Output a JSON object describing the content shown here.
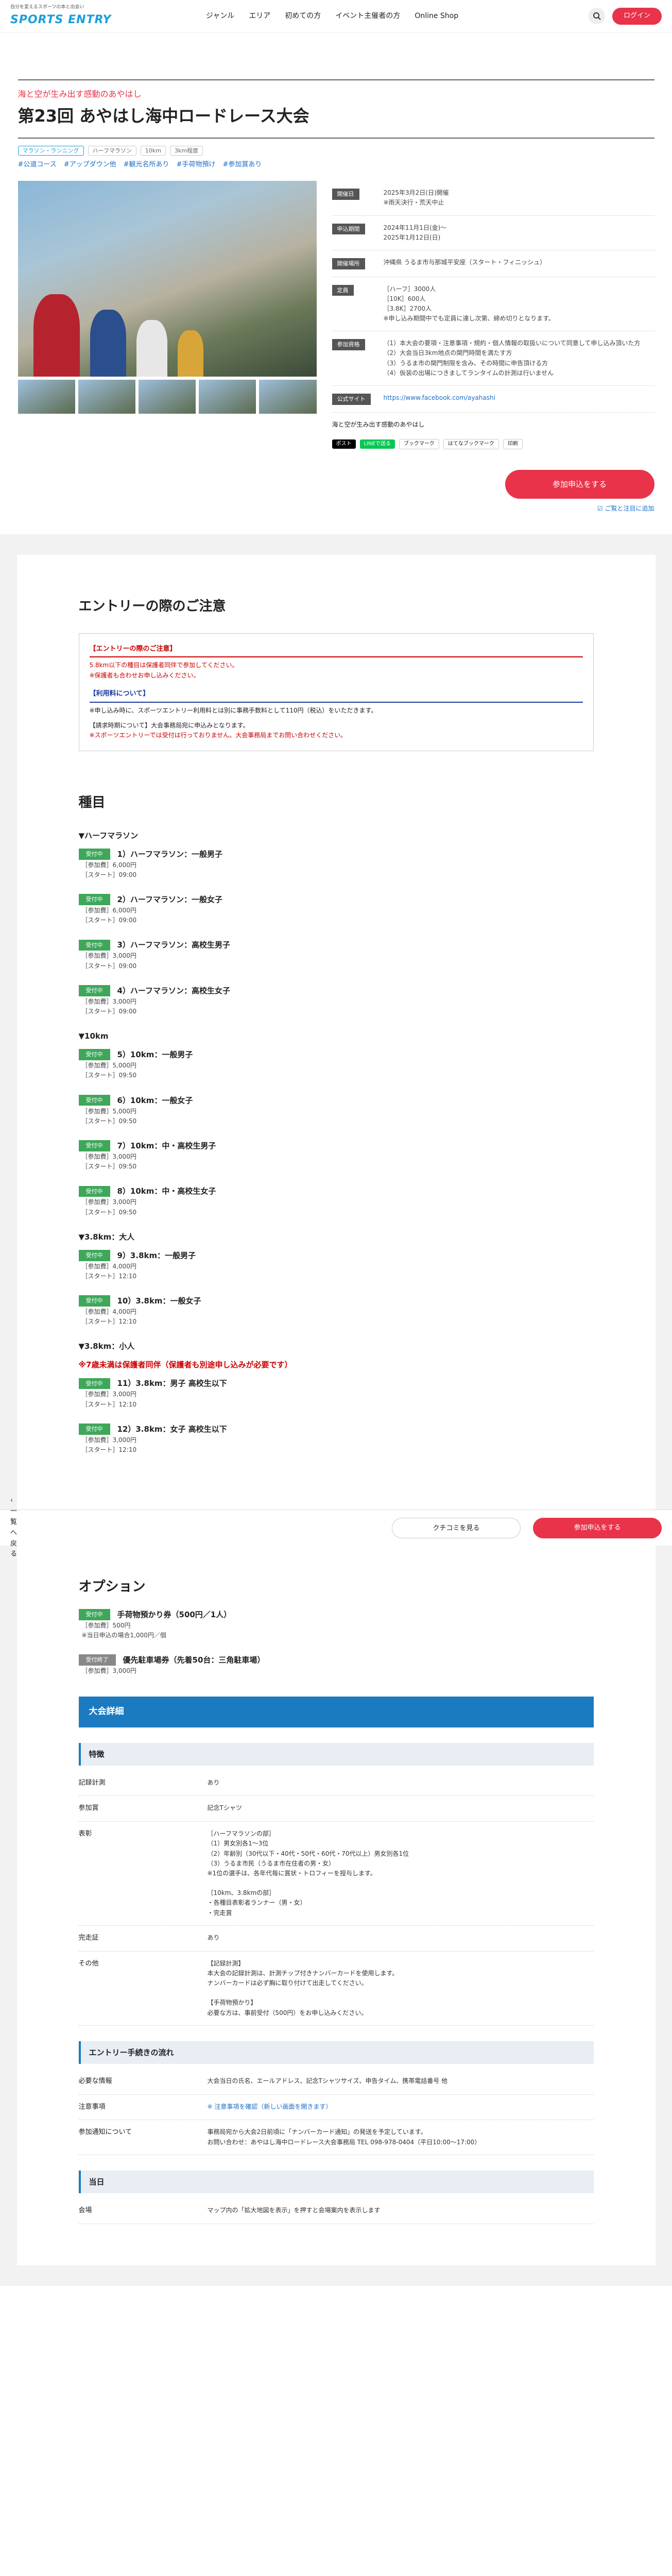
{
  "header": {
    "tagline": "自分を変えるスポーツの本と出会い",
    "logo": "SPORTS ENTRY",
    "nav": [
      "ジャンル",
      "エリア",
      "初めての方",
      "イベント主催者の方",
      "Online Shop"
    ],
    "login": "ログイン"
  },
  "event": {
    "catch": "海と空が生み出す感動のあやはし",
    "title": "第23回 あやはし海中ロードレース大会",
    "tags": [
      "マラソン・ランニング",
      "ハーフマラソン",
      "10km",
      "3km程度"
    ],
    "features": [
      "#公道コース",
      "#アップダウン他",
      "#観光名所あり",
      "#手荷物預け",
      "#参加賞あり"
    ],
    "facts": [
      {
        "label": "開催日",
        "value": "2025年3月2日(日)開催\n※雨天決行・荒天中止"
      },
      {
        "label": "申込期間",
        "value": "2024年11月1日(金)～\n2025年1月12日(日)"
      },
      {
        "label": "開催場所",
        "value": "沖縄県 うるま市与那城平安座（スタート・フィニッシュ）"
      },
      {
        "label": "定員",
        "value": "［ハーフ］3000人\n［10K］600人\n［3.8K］2700人\n※申し込み期間中でも定員に達し次第、締め切りとなります。"
      },
      {
        "label": "参加資格",
        "value": "（1）本大会の要項・注意事項・規約・個人情報の取扱いについて同意して申し込み頂いた方\n（2）大会当日3km地点の関門時間を満たす方\n（3）うるま市の関門制限を含み、その時間に申告頂ける方\n（4）仮装の出場につきましてランタイムの計測は行いません"
      },
      {
        "label": "公式サイト",
        "value": "https://www.facebook.com/ayahashi"
      }
    ],
    "summary": "海と空が生み出す感動のあやはし",
    "share": [
      "ポスト",
      "LINEで送る",
      "ブックマーク",
      "はてなブックマーク",
      "印刷"
    ],
    "apply": "参加申込をする",
    "favorite": "ご覧と注目に追加"
  },
  "notice": {
    "title": "エントリーの際のご注意",
    "h1": "【エントリーの際のご注意】",
    "p1": "5.8km以下の種目は保護者同伴で参加してください。",
    "p2": "※保護者も合わせお申し込みください。",
    "h2": "【利用料について】",
    "p3": "※申し込み時に、スポーツエントリー利用料とは別に事務手数料として110円（税込）をいただきます。",
    "p4": "【請求時期について】大会事務局宛に申込みとなります。",
    "p5": "※スポーツエントリーでは受付は行っておりません。大会事務局までお問い合わせください。"
  },
  "events": {
    "title": "種目",
    "groups": [
      {
        "name": "▼ハーフマラソン",
        "note": "",
        "items": [
          {
            "badge": "受付中",
            "name": "1）ハーフマラソン：一般男子",
            "fee": "［参加費］6,000円",
            "start": "［スタート］09:00"
          },
          {
            "badge": "受付中",
            "name": "2）ハーフマラソン：一般女子",
            "fee": "［参加費］6,000円",
            "start": "［スタート］09:00"
          },
          {
            "badge": "受付中",
            "name": "3）ハーフマラソン：高校生男子",
            "fee": "［参加費］3,000円",
            "start": "［スタート］09:00"
          },
          {
            "badge": "受付中",
            "name": "4）ハーフマラソン：高校生女子",
            "fee": "［参加費］3,000円",
            "start": "［スタート］09:00"
          }
        ]
      },
      {
        "name": "▼10km",
        "note": "",
        "items": [
          {
            "badge": "受付中",
            "name": "5）10km：一般男子",
            "fee": "［参加費］5,000円",
            "start": "［スタート］09:50"
          },
          {
            "badge": "受付中",
            "name": "6）10km：一般女子",
            "fee": "［参加費］5,000円",
            "start": "［スタート］09:50"
          },
          {
            "badge": "受付中",
            "name": "7）10km：中・高校生男子",
            "fee": "［参加費］3,000円",
            "start": "［スタート］09:50"
          },
          {
            "badge": "受付中",
            "name": "8）10km：中・高校生女子",
            "fee": "［参加費］3,000円",
            "start": "［スタート］09:50"
          }
        ]
      },
      {
        "name": "▼3.8km：大人",
        "note": "",
        "items": [
          {
            "badge": "受付中",
            "name": "9）3.8km：一般男子",
            "fee": "［参加費］4,000円",
            "start": "［スタート］12:10"
          },
          {
            "badge": "受付中",
            "name": "10）3.8km：一般女子",
            "fee": "［参加費］4,000円",
            "start": "［スタート］12:10"
          }
        ]
      },
      {
        "name": "▼3.8km：小人",
        "note": "※7歳未満は保護者同伴（保護者も別途申し込みが必要です）",
        "items": [
          {
            "badge": "受付中",
            "name": "11）3.8km：男子 高校生以下",
            "fee": "［参加費］3,000円",
            "start": "［スタート］12:10"
          },
          {
            "badge": "受付中",
            "name": "12）3.8km：女子 高校生以下",
            "fee": "［参加費］3,000円",
            "start": "［スタート］12:10"
          }
        ]
      }
    ]
  },
  "bar": {
    "back": "一覧へ戻る",
    "check": "クチコミを見る",
    "apply": "参加申込をする"
  },
  "options": {
    "title": "オプション",
    "items": [
      {
        "badge": "受付中",
        "name": "手荷物預かり券（500円／1人）",
        "lines": [
          "［参加費］500円",
          "※当日申込の場合1,000円／個"
        ]
      },
      {
        "badge": "受付終了",
        "name": "優先駐車場券（先着50台：三角駐車場）",
        "lines": [
          "［参加費］3,000円"
        ]
      }
    ]
  },
  "details": {
    "title": "大会詳細",
    "sec1": "特徴",
    "rows": [
      {
        "label": "記録計測",
        "value": "あり"
      },
      {
        "label": "参加賞",
        "value": "記念Tシャツ"
      },
      {
        "label": "表彰",
        "value": "［ハーフマラソンの部］\n（1）男女別各1〜3位\n（2）年齢別（30代以下・40代・50代・60代・70代以上）男女別各1位\n（3）うるま市民（うるま市在住者の男・女）\n※1位の選手は、各年代毎に賞状・トロフィーを授与します。\n\n［10km、3.8kmの部］\n・各種目表彰者ランナー（男・女）\n・完走賞"
      },
      {
        "label": "完走証",
        "value": "あり"
      },
      {
        "label": "その他",
        "value": "【記録計測】\n本大会の記録計測は、計測チップ付きナンバーカードを使用します。\nナンバーカードは必ず胸に取り付けて出走してください。\n\n【手荷物預かり】\n必要な方は、事前受付（500円）をお申し込みください。"
      }
    ],
    "sec2": "エントリー手続きの流れ",
    "rows2": [
      {
        "label": "必要な情報",
        "value": "大会当日の氏名、エールアドレス、記念Tシャツサイズ、申告タイム、携帯電話番号 他"
      },
      {
        "label": "注意事項",
        "value": "※ 注意事項を確認（新しい画面を開きます）"
      },
      {
        "label": "参加通知について",
        "value": "事務局宛から大会2日前頃に「ナンバーカード通知」の発送を予定しています。\nお問い合わせ：あやはし海中ロードレース大会事務局 TEL 098-978-0404（平日10:00〜17:00）"
      }
    ],
    "sec3": "当日",
    "rows3": [
      {
        "label": "会場",
        "value": "マップ内の「拡大地図を表示」を押すと会場案内を表示します"
      }
    ]
  }
}
